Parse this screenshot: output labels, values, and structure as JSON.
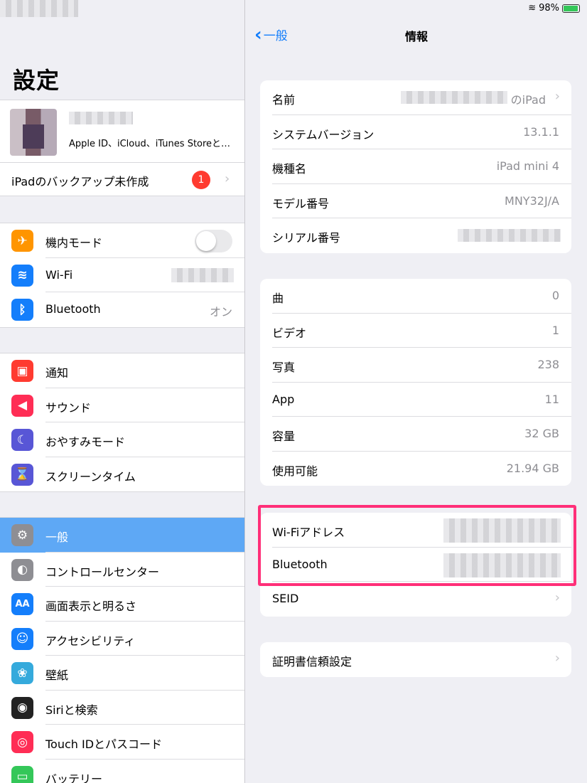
{
  "left": {
    "title": "設定",
    "profile": {
      "subtitle": "Apple ID、iCloud、iTunes Storeと…"
    },
    "backup": {
      "label": "iPadのバックアップ未作成",
      "badge": "1"
    },
    "group1": [
      {
        "label": "機内モード",
        "icon": "airplane-icon",
        "color": "#ff9500",
        "glyph": "✈"
      },
      {
        "label": "Wi-Fi",
        "icon": "wifi-icon",
        "color": "#147efb",
        "glyph": "≋"
      },
      {
        "label": "Bluetooth",
        "icon": "bluetooth-icon",
        "color": "#147efb",
        "glyph": "ᛒ",
        "value": "オン"
      }
    ],
    "group2": [
      {
        "label": "通知",
        "icon": "notifications-icon",
        "color": "#ff3b30",
        "glyph": "▣"
      },
      {
        "label": "サウンド",
        "icon": "sound-icon",
        "color": "#ff2d55",
        "glyph": "◀"
      },
      {
        "label": "おやすみモード",
        "icon": "moon-icon",
        "color": "#5856d6",
        "glyph": "☾"
      },
      {
        "label": "スクリーンタイム",
        "icon": "hourglass-icon",
        "color": "#5856d6",
        "glyph": "⌛"
      }
    ],
    "group3": [
      {
        "label": "一般",
        "icon": "gear-icon",
        "color": "#8e8e93",
        "glyph": "⚙"
      },
      {
        "label": "コントロールセンター",
        "icon": "control-center-icon",
        "color": "#8e8e93",
        "glyph": "◐"
      },
      {
        "label": "画面表示と明るさ",
        "icon": "display-icon",
        "color": "#147efb",
        "glyph": "AA"
      },
      {
        "label": "アクセシビリティ",
        "icon": "accessibility-icon",
        "color": "#147efb",
        "glyph": "☺"
      },
      {
        "label": "壁紙",
        "icon": "wallpaper-icon",
        "color": "#35aadc",
        "glyph": "❀"
      },
      {
        "label": "Siriと検索",
        "icon": "siri-icon",
        "color": "#222222",
        "glyph": "◉"
      },
      {
        "label": "Touch IDとパスコード",
        "icon": "fingerprint-icon",
        "color": "#ff2d55",
        "glyph": "◎"
      },
      {
        "label": "バッテリー",
        "icon": "battery-icon",
        "color": "#34c759",
        "glyph": "▭"
      }
    ]
  },
  "right": {
    "status": {
      "battery": "98%"
    },
    "nav": {
      "back": "一般",
      "title": "情報"
    },
    "card1": [
      {
        "label": "名前",
        "value": "のiPad",
        "chevron": true
      },
      {
        "label": "システムバージョン",
        "value": "13.1.1"
      },
      {
        "label": "機種名",
        "value": "iPad mini 4"
      },
      {
        "label": "モデル番号",
        "value": "MNY32J/A"
      },
      {
        "label": "シリアル番号",
        "value": ""
      }
    ],
    "card2": [
      {
        "label": "曲",
        "value": "0"
      },
      {
        "label": "ビデオ",
        "value": "1"
      },
      {
        "label": "写真",
        "value": "238"
      },
      {
        "label": "App",
        "value": "11"
      },
      {
        "label": "容量",
        "value": "32 GB"
      },
      {
        "label": "使用可能",
        "value": "21.94 GB"
      }
    ],
    "card3": [
      {
        "label": "Wi-Fiアドレス",
        "value": ""
      },
      {
        "label": "Bluetooth",
        "value": ""
      },
      {
        "label": "SEID",
        "value": "",
        "chevron": true
      }
    ],
    "card4": [
      {
        "label": "証明書信頼設定",
        "value": "",
        "chevron": true
      }
    ]
  }
}
